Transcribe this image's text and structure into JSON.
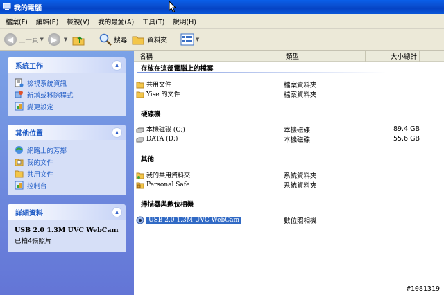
{
  "window": {
    "title": "我的電腦"
  },
  "menu": [
    "檔案(F)",
    "編輯(E)",
    "檢視(V)",
    "我的最愛(A)",
    "工具(T)",
    "說明(H)"
  ],
  "toolbar": {
    "back": "上一頁",
    "search": "搜尋",
    "folders": "資料夾"
  },
  "columns": {
    "name": "名稱",
    "type": "類型",
    "size": "大小總計"
  },
  "tasks": {
    "system": {
      "title": "系統工作",
      "items": [
        "檢視系統資訊",
        "新增或移除程式",
        "變更設定"
      ]
    },
    "other": {
      "title": "其他位置",
      "items": [
        "網路上的芳鄰",
        "我的文件",
        "共用文件",
        "控制台"
      ]
    },
    "details": {
      "title": "詳細資料",
      "name": "USB 2.0 1.3M UVC WebCam",
      "info": "已拍4張照片"
    }
  },
  "groups": {
    "files": {
      "title": "存放在這部電腦上的檔案",
      "rows": [
        {
          "name": "共用文件",
          "type": "檔案資料夾"
        },
        {
          "name": "Yise 的文件",
          "type": "檔案資料夾"
        }
      ]
    },
    "drives": {
      "title": "硬碟機",
      "rows": [
        {
          "name": "本機磁碟 (C:)",
          "type": "本機磁碟",
          "size": "89.4 GB"
        },
        {
          "name": "DATA (D:)",
          "type": "本機磁碟",
          "size": "55.6 GB"
        }
      ]
    },
    "other": {
      "title": "其他",
      "rows": [
        {
          "name": "我的共用資料夾",
          "type": "系統資料夾"
        },
        {
          "name": "Personal Safe",
          "type": "系統資料夾"
        }
      ]
    },
    "scanners": {
      "title": "掃描器與數位相機",
      "rows": [
        {
          "name": "USB 2.0 1.3M UVC WebCam",
          "type": "數位照相機"
        }
      ]
    }
  },
  "watermark": "#1081319",
  "colors": {
    "titlebar": "#0a4fd0",
    "taskpane": "#7ba2e7",
    "selection": "#316ac5"
  }
}
